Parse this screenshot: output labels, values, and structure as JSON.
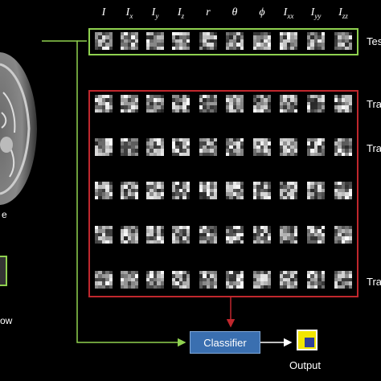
{
  "headers": [
    "I",
    "Ix",
    "Iy",
    "Iz",
    "r",
    "θ",
    "ϕ",
    "Ixx",
    "Iyy",
    "Izz"
  ],
  "header_display": [
    {
      "base": "I",
      "sub": ""
    },
    {
      "base": "I",
      "sub": "x"
    },
    {
      "base": "I",
      "sub": "y"
    },
    {
      "base": "I",
      "sub": "z"
    },
    {
      "base": "r",
      "sub": ""
    },
    {
      "base": "θ",
      "sub": ""
    },
    {
      "base": "ϕ",
      "sub": ""
    },
    {
      "base": "I",
      "sub": "xx"
    },
    {
      "base": "I",
      "sub": "yy"
    },
    {
      "base": "I",
      "sub": "zz"
    }
  ],
  "labels": {
    "test": "Tes",
    "train_1": "Tra",
    "train_2": "Tra",
    "train_3": "Tra",
    "classifier": "Classifier",
    "output": "Output",
    "left_image": "e",
    "left_window": "ow"
  },
  "colors": {
    "test_border": "#8fd14f",
    "train_border": "#c0272d",
    "classifier_fill": "#3a6fb0",
    "output_yellow": "#f2e600",
    "output_blue": "#2f3f9a"
  }
}
